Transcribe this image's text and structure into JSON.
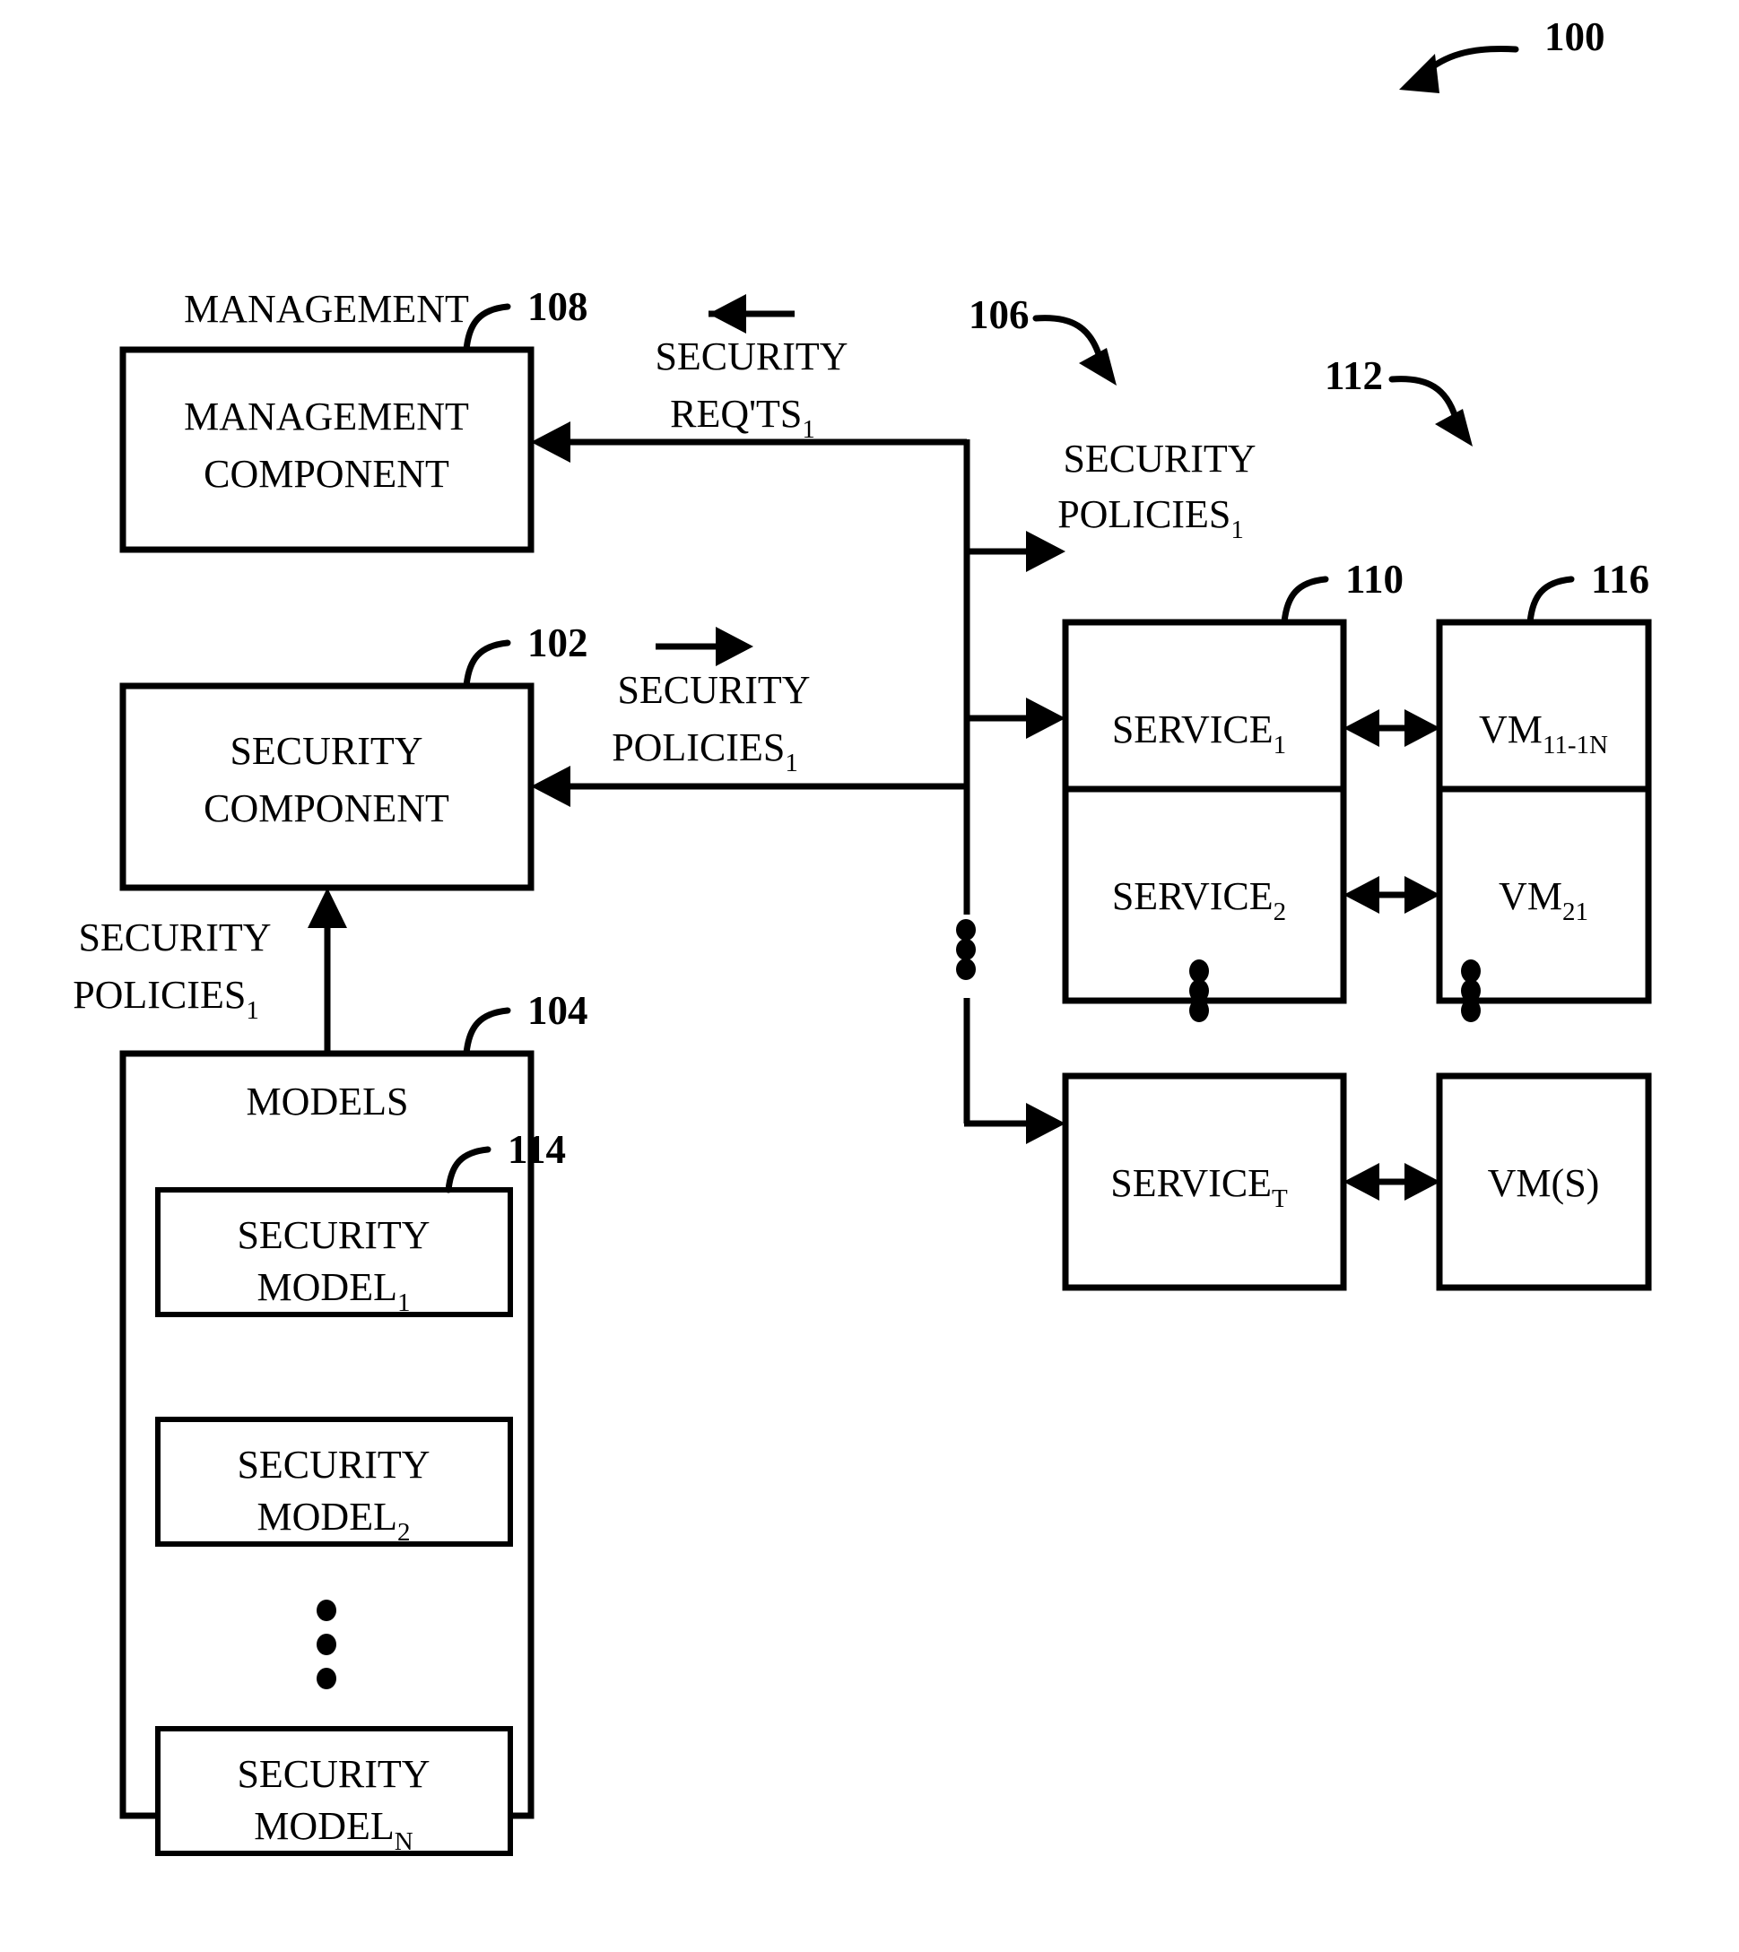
{
  "figure": {
    "reference_label": "100",
    "boxes": [
      {
        "id": "management-component",
        "ref": "108",
        "line1": "MANAGEMENT",
        "line2": "COMPONENT"
      },
      {
        "id": "security-component",
        "ref": "102",
        "line1": "SECURITY",
        "line2": "COMPONENT"
      },
      {
        "id": "models",
        "ref": "104",
        "title": "MODELS"
      }
    ],
    "security_models": {
      "ref": "114",
      "items": [
        {
          "line1": "SECURITY",
          "line2": "MODEL",
          "sub": "1"
        },
        {
          "line1": "SECURITY",
          "line2": "MODEL",
          "sub": "2"
        },
        {
          "line1": "SECURITY",
          "line2": "MODEL",
          "sub": "N"
        }
      ],
      "ellipsis": "⋮"
    },
    "services": {
      "ref": "110",
      "bus_ref": "106",
      "group_ref": "112",
      "items": [
        {
          "label": "SERVICE",
          "sub": "1"
        },
        {
          "label": "SERVICE",
          "sub": "2"
        },
        {
          "label": "SERVICE",
          "sub": "T"
        }
      ]
    },
    "vms": {
      "ref": "116",
      "items": [
        {
          "label": "VM",
          "sub": "11-1N"
        },
        {
          "label": "VM",
          "sub": "21"
        },
        {
          "label": "VM(S)",
          "sub": ""
        }
      ]
    },
    "flows": [
      {
        "id": "security-requests",
        "line1": "SECURITY",
        "line2": "REQ'TS",
        "sub": "1",
        "direction": "left",
        "arrow_glyph": "←"
      },
      {
        "id": "security-policies-to-security-component",
        "line1": "SECURITY",
        "line2": "POLICIES",
        "sub": "1",
        "direction": "right",
        "arrow_glyph": "→"
      },
      {
        "id": "security-policies-to-services",
        "line1": "SECURITY",
        "line2": "POLICIES",
        "sub": "1",
        "direction": "none",
        "arrow_glyph": ""
      },
      {
        "id": "security-policies-from-models",
        "line1": "SECURITY",
        "line2": "POLICIES",
        "sub": "1",
        "direction": "up",
        "arrow_glyph": "↑"
      }
    ],
    "colors": {
      "stroke": "#000000",
      "fill": "#ffffff",
      "background": "#ffffff"
    }
  }
}
